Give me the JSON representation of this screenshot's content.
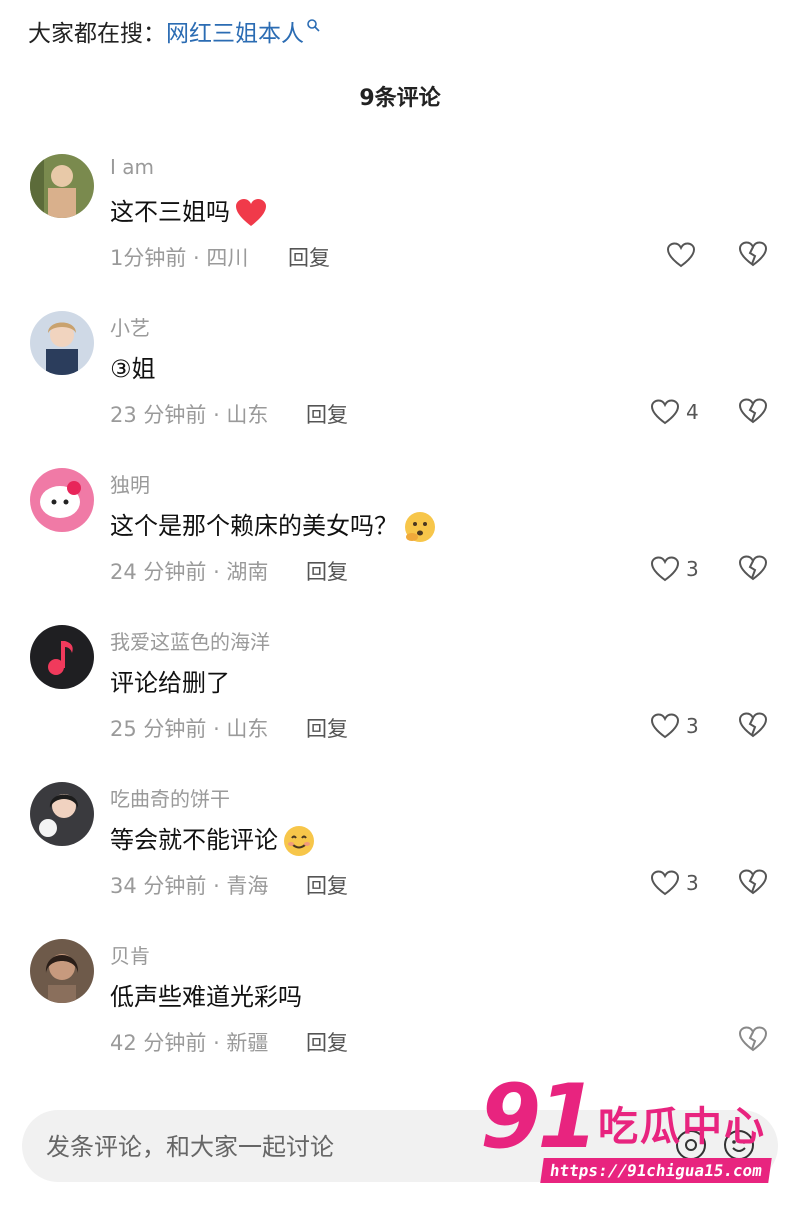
{
  "header": {
    "search_prefix": "大家都在搜：",
    "search_keyword": "网红三姐本人"
  },
  "comments_count": "9条评论",
  "comments": [
    {
      "user": "I am",
      "text": "这不三姐吗",
      "time": "1分钟前 · 四川",
      "reply": "回复",
      "likes": "",
      "emoji": "heart"
    },
    {
      "user": "小艺",
      "text": "③姐",
      "time": "23 分钟前 · 山东",
      "reply": "回复",
      "likes": "4",
      "emoji": ""
    },
    {
      "user": "独明",
      "text": "这个是那个赖床的美女吗？",
      "time": "24 分钟前 · 湖南",
      "reply": "回复",
      "likes": "3",
      "emoji": "thinking"
    },
    {
      "user": "我爱这蓝色的海洋",
      "text": "评论给删了",
      "time": "25 分钟前 · 山东",
      "reply": "回复",
      "likes": "3",
      "emoji": ""
    },
    {
      "user": "吃曲奇的饼干",
      "text": "等会就不能评论",
      "time": "34 分钟前 · 青海",
      "reply": "回复",
      "likes": "3",
      "emoji": "smile"
    },
    {
      "user": "贝肯",
      "text": "低声些难道光彩吗",
      "time": "42 分钟前 · 新疆",
      "reply": "回复",
      "likes": "",
      "emoji": ""
    }
  ],
  "input": {
    "placeholder": "发条评论，和大家一起讨论"
  },
  "watermark": {
    "logo": "91",
    "name": "吃瓜中心",
    "url": "https://91chigua15.com"
  },
  "colors": {
    "accent_link": "#2b6cb3",
    "watermark": "#e8247f"
  }
}
